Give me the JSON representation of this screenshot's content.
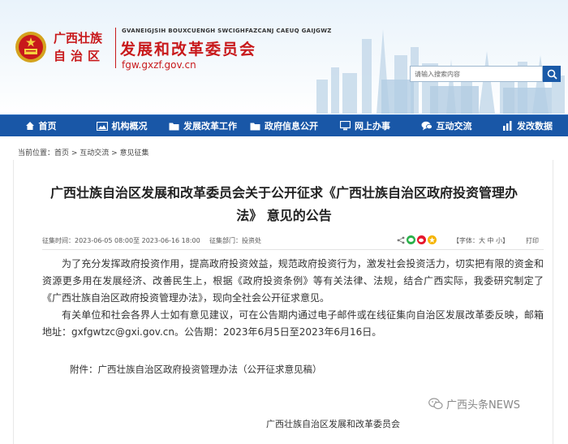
{
  "header": {
    "region_line1": "广西壮族",
    "region_line2": "自治区",
    "zhuang_name": "GVANEIGJSIH BOUXCUENGH SWCIGHFAZCANJ CAEUQ GAIJGWZ",
    "org_name": "发展和改革委员会",
    "domain": "fgw.gxzf.gov.cn",
    "search_placeholder": "请输入搜索内容"
  },
  "nav": {
    "items": [
      {
        "label": "首页",
        "icon": "home-icon"
      },
      {
        "label": "机构概况",
        "icon": "picture-icon"
      },
      {
        "label": "发展改革工作",
        "icon": "folder-icon"
      },
      {
        "label": "政府信息公开",
        "icon": "folder-icon"
      },
      {
        "label": "网上办事",
        "icon": "monitor-icon"
      },
      {
        "label": "互动交流",
        "icon": "chat-icon"
      },
      {
        "label": "发改数据",
        "icon": "bar-chart-icon"
      }
    ]
  },
  "breadcrumb": {
    "text": "当前位置：首页 > 互动交流 > 意见征集"
  },
  "article": {
    "title_line1": "广西壮族自治区发展和改革委员会关于公开征求《广西壮族自治区政府投资管理办",
    "title_line2": "法》 意见的公告",
    "meta_period": "征集时间：2023-06-05 08:00至 2023-06-16 18:00",
    "meta_dept": "征集部门：投资处",
    "font_size_label": "【字体：大 中 小】",
    "print_label": "打印",
    "para1": "为了充分发挥政府投资作用，提高政府投资效益，规范政府投资行为，激发社会投资活力，切实把有限的资金和资源更多用在发展经济、改善民生上，根据《政府投资条例》等有关法律、法规，结合广西实际，我委研究制定了《广西壮族自治区政府投资管理办法》，现向全社会公开征求意见。",
    "para2": "有关单位和社会各界人士如有意见建议，可在公告期内通过电子邮件或在线征集向自治区发展改革委反映，邮箱地址：gxfgwtzc@gxi.gov.cn。公告期：2023年6月5日至2023年6月16日。",
    "attachment": "附件：广西壮族自治区政府投资管理办法（公开征求意见稿）",
    "signature": "广西壮族自治区发展和改革委员会"
  },
  "watermark": {
    "text": "广西头条NEWS"
  },
  "colors": {
    "brand_red": "#c8191b",
    "nav_blue": "#1957a7"
  }
}
